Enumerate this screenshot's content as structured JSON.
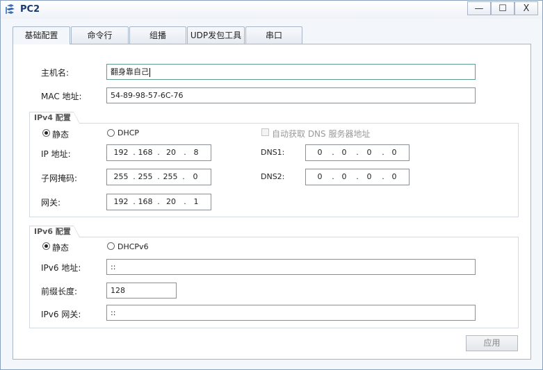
{
  "window": {
    "title": "PC2",
    "minimize": "—",
    "maximize": "☐",
    "close": "X"
  },
  "tabs": [
    {
      "label": "基础配置",
      "active": true
    },
    {
      "label": "命令行",
      "active": false
    },
    {
      "label": "组播",
      "active": false
    },
    {
      "label": "UDP发包工具",
      "active": false
    },
    {
      "label": "串口",
      "active": false
    }
  ],
  "basic": {
    "hostname_label": "主机名:",
    "hostname_value": "翻身靠自己",
    "mac_label": "MAC 地址:",
    "mac_value": "54-89-98-57-6C-76"
  },
  "ipv4": {
    "group_title": "IPv4 配置",
    "static_label": "静态",
    "dhcp_label": "DHCP",
    "mode": "static",
    "auto_dns_label": "自动获取 DNS 服务器地址",
    "ip_label": "IP 地址:",
    "ip": [
      "192",
      "168",
      "20",
      "8"
    ],
    "mask_label": "子网掩码:",
    "mask": [
      "255",
      "255",
      "255",
      "0"
    ],
    "gateway_label": "网关:",
    "gateway": [
      "192",
      "168",
      "20",
      "1"
    ],
    "dns1_label": "DNS1:",
    "dns1": [
      "0",
      "0",
      "0",
      "0"
    ],
    "dns2_label": "DNS2:",
    "dns2": [
      "0",
      "0",
      "0",
      "0"
    ]
  },
  "ipv6": {
    "group_title": "IPv6 配置",
    "static_label": "静态",
    "dhcp_label": "DHCPv6",
    "mode": "static",
    "addr_label": "IPv6 地址:",
    "addr_value": "::",
    "prefix_label": "前缀长度:",
    "prefix_value": "128",
    "gateway_label": "IPv6 网关:",
    "gateway_value": "::"
  },
  "apply_label": "应用"
}
